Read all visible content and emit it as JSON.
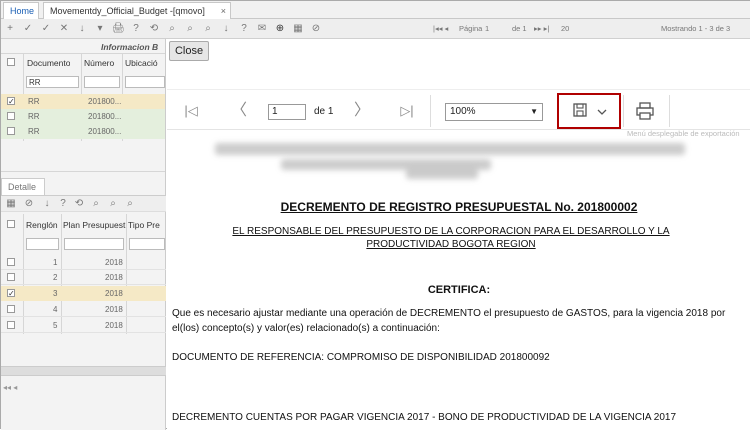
{
  "tabs": {
    "home": "Home",
    "movement": "Movementdy_Official_Budget -[qmovo]",
    "close_symbol": "×"
  },
  "toolbar": {
    "icons": [
      "+",
      "✓",
      "✓",
      "✕",
      "↓",
      "▾",
      "🖨",
      "?",
      "⟲",
      "⌕",
      "⌕",
      "⌕",
      "↓",
      "?",
      "✉",
      "⊕",
      "▦",
      "⊘"
    ],
    "pagination": {
      "first_prev": "|◂◂ ◂",
      "page_label": "Página",
      "page_value": "1",
      "of_label": "de 1",
      "next_last": "▸▸ ▸|",
      "per_page": "20",
      "showing": "Mostrando 1 - 3 de 3"
    }
  },
  "master_grid": {
    "group_header": "Informacion B",
    "columns": [
      "Documento",
      "Número",
      "Ubicació"
    ],
    "filter_value": "RR",
    "rows": [
      {
        "checked": true,
        "documento": "RR",
        "numero": "201800..."
      },
      {
        "checked": false,
        "documento": "RR",
        "numero": "201800..."
      },
      {
        "checked": false,
        "documento": "RR",
        "numero": "201800..."
      }
    ]
  },
  "detail": {
    "tab_label": "Detalle",
    "columns": [
      "Renglón",
      "Plan Presupuest",
      "Tipo Pre"
    ],
    "rows": [
      {
        "checked": false,
        "renglon": "1",
        "plan": "2018"
      },
      {
        "checked": false,
        "renglon": "2",
        "plan": "2018"
      },
      {
        "checked": true,
        "renglon": "3",
        "plan": "2018"
      },
      {
        "checked": false,
        "renglon": "4",
        "plan": "2018"
      },
      {
        "checked": false,
        "renglon": "5",
        "plan": "2018"
      }
    ]
  },
  "viewer": {
    "close_label": "Close",
    "first_icon": "|◁",
    "prev_icon": "〈",
    "next_icon": "〉",
    "last_icon": "▷|",
    "page_value": "1",
    "of_label": "de 1",
    "zoom_value": "100%",
    "zoom_arrow": "▼",
    "tooltip": "Menú desplegable de exportación"
  },
  "document": {
    "title": "DECREMENTO DE REGISTRO PRESUPUESTAL No. 201800002",
    "subtitle": "EL RESPONSABLE DEL PRESUPUESTO DE LA  CORPORACION PARA EL DESARROLLO Y LA PRODUCTIVIDAD BOGOTA REGION",
    "certifica": "CERTIFICA:",
    "paragraph": "Que es necesario ajustar mediante una operación de DECREMENTO el presupuesto de GASTOS, para la vigencia 2018 por el(los) concepto(s) y valor(es) relacionado(s) a continuación:",
    "reference": "DOCUMENTO DE REFERENCIA: COMPROMISO DE DISPONIBILIDAD 201800092",
    "decrement": "DECREMENTO CUENTAS POR PAGAR VIGENCIA 2017 - BONO DE PRODUCTIVIDAD DE LA VIGENCIA 2017"
  },
  "colors": {
    "selected_row": "#f5e9c6",
    "green_row": "#e4efdd",
    "highlight_border": "#b00000",
    "link_blue": "#1a5fb4"
  }
}
